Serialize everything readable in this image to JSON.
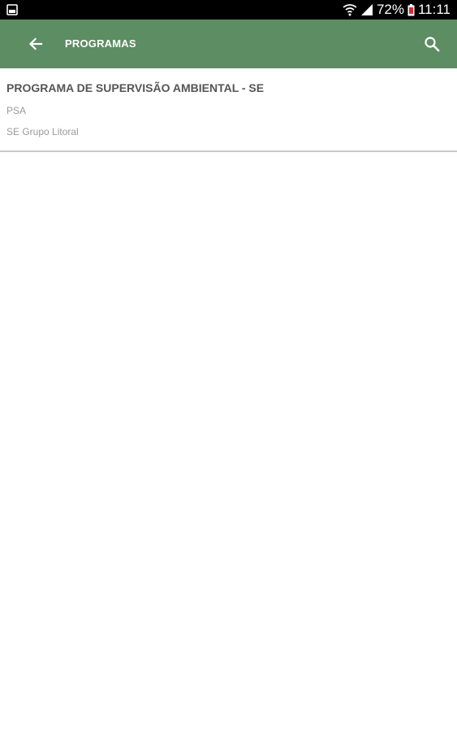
{
  "status_bar": {
    "battery_percent": "72%",
    "time": "11:11",
    "icons": [
      "gallery-icon",
      "wifi-icon",
      "signal-icon",
      "battery-icon"
    ]
  },
  "appbar": {
    "title": "PROGRAMAS",
    "background_color": "#5d8d62",
    "back_icon": "arrow-left-icon",
    "search_icon": "search-icon"
  },
  "programs": [
    {
      "title": "PROGRAMA DE SUPERVISÃO AMBIENTAL - SE",
      "code": "PSA",
      "group": "SE Grupo Litoral"
    }
  ]
}
